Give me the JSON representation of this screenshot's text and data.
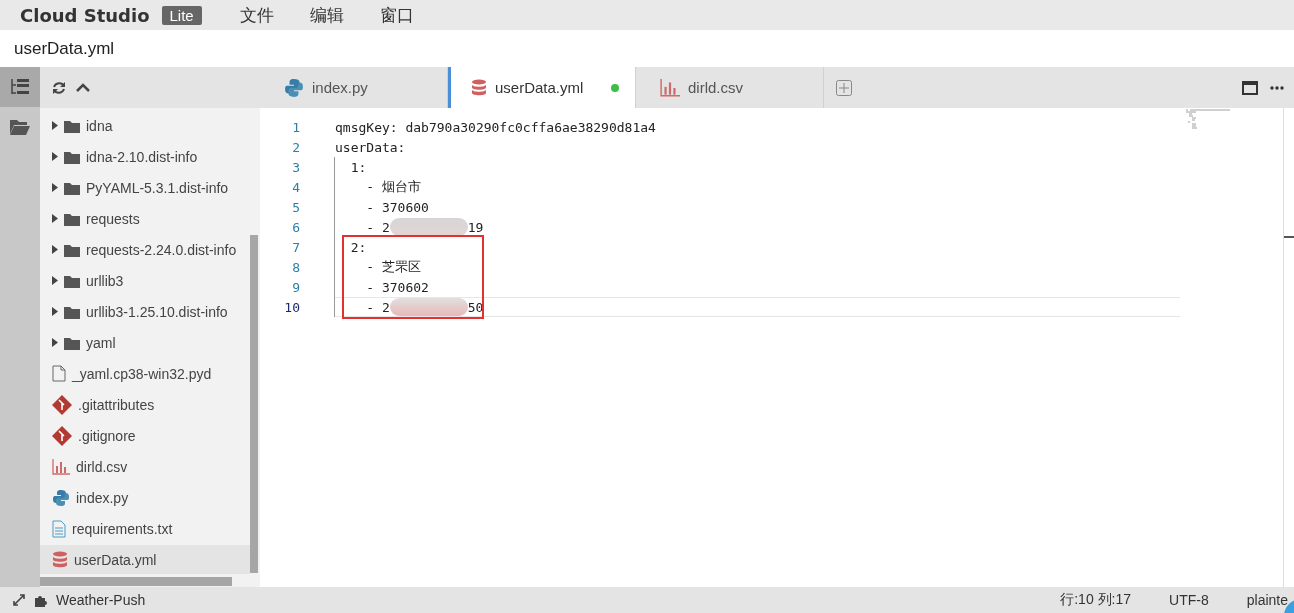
{
  "menu_bar": {
    "brand": "Cloud Studio",
    "badge": "Lite",
    "menus": [
      "文件",
      "编辑",
      "窗口"
    ]
  },
  "title_bar": {
    "title": "userData.yml"
  },
  "activity_bar": [
    {
      "kind": "tree",
      "selected": true
    },
    {
      "kind": "folder",
      "selected": false
    }
  ],
  "files": [
    {
      "name": "idna",
      "kind": "folder",
      "expanded": false,
      "selected": false
    },
    {
      "name": "idna-2.10.dist-info",
      "kind": "folder",
      "expanded": false,
      "selected": false
    },
    {
      "name": "PyYAML-5.3.1.dist-info",
      "kind": "folder",
      "expanded": false,
      "selected": false
    },
    {
      "name": "requests",
      "kind": "folder",
      "expanded": false,
      "selected": false
    },
    {
      "name": "requests-2.24.0.dist-info",
      "kind": "folder",
      "expanded": false,
      "selected": false
    },
    {
      "name": "urllib3",
      "kind": "folder",
      "expanded": false,
      "selected": false
    },
    {
      "name": "urllib3-1.25.10.dist-info",
      "kind": "folder",
      "expanded": false,
      "selected": false
    },
    {
      "name": "yaml",
      "kind": "folder",
      "expanded": false,
      "selected": false
    },
    {
      "name": "_yaml.cp38-win32.pyd",
      "kind": "file",
      "selected": false
    },
    {
      "name": ".gitattributes",
      "kind": "git",
      "selected": false
    },
    {
      "name": ".gitignore",
      "kind": "git",
      "selected": false
    },
    {
      "name": "dirld.csv",
      "kind": "chart",
      "selected": false
    },
    {
      "name": "index.py",
      "kind": "python",
      "selected": false
    },
    {
      "name": "requirements.txt",
      "kind": "text",
      "selected": false
    },
    {
      "name": "userData.yml",
      "kind": "database",
      "selected": true
    }
  ],
  "tabs": [
    {
      "label": "index.py",
      "kind": "python",
      "selected": false,
      "modified": false
    },
    {
      "label": "userData.yml",
      "kind": "database",
      "selected": true,
      "modified": true
    },
    {
      "label": "dirld.csv",
      "kind": "chart",
      "selected": false,
      "modified": false
    }
  ],
  "code_lines": [
    {
      "number": "1",
      "text": "qmsgKey: dab790a30290fc0cffa6ae38290d81a4",
      "highlighted": false,
      "current": false
    },
    {
      "number": "2",
      "text": "userData:",
      "highlighted": false,
      "current": false
    },
    {
      "number": "3",
      "text": "  1:",
      "highlighted": false,
      "current": false
    },
    {
      "number": "4",
      "text": "    - 烟台市",
      "highlighted": false,
      "current": false
    },
    {
      "number": "5",
      "text": "    - 370600",
      "highlighted": false,
      "current": false
    },
    {
      "number": "6",
      "text": "    - 2",
      "redacted": true,
      "after": "19",
      "highlighted": false,
      "current": false
    },
    {
      "number": "7",
      "text": "  2:",
      "highlighted": true,
      "current": false
    },
    {
      "number": "8",
      "text": "    - 芝罘区",
      "highlighted": true,
      "current": false
    },
    {
      "number": "9",
      "text": "    - 370602",
      "highlighted": true,
      "current": false
    },
    {
      "number": "10",
      "text": "    - 2",
      "redacted": true,
      "after": "50",
      "highlighted": true,
      "current": true
    }
  ],
  "status_bar": {
    "project": "Weather-Push",
    "position": "行:10 列:17",
    "encoding": "UTF-8",
    "language": "plainte"
  }
}
